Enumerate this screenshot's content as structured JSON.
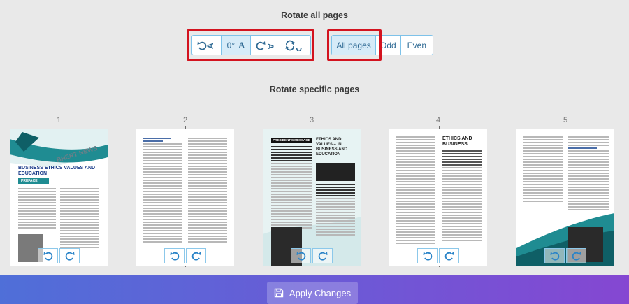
{
  "rotate_all": {
    "title": "Rotate all pages",
    "buttons": [
      {
        "icon": "rotate-left-icon",
        "glyph": "A"
      },
      {
        "label": "0°",
        "glyph": "A"
      },
      {
        "icon": "rotate-right-icon",
        "glyph": "A"
      },
      {
        "icon": "flip-icon",
        "glyph": "A"
      }
    ],
    "selection": [
      "All pages",
      "Odd",
      "Even"
    ],
    "selected": "All pages"
  },
  "rotate_specific": {
    "title": "Rotate specific pages",
    "pages": [
      {
        "num": "1"
      },
      {
        "num": "2"
      },
      {
        "num": "3"
      },
      {
        "num": "4"
      },
      {
        "num": "5"
      }
    ]
  },
  "thumb_text": {
    "p1_masthead": "BHERT NEWS",
    "p1_heading": "BUSINESS ETHICS VALUES AND EDUCATION",
    "p1_band": "PREFACE",
    "p3_banner": "PRESIDENT'S MESSAGE",
    "p3_heading": "ETHICS AND VALUES – IN BUSINESS AND EDUCATION",
    "p4_heading": "ETHICS AND BUSINESS"
  },
  "footer": {
    "apply_label": "Apply Changes"
  },
  "colors": {
    "accent": "#2f6a94",
    "highlight": "#d3131f",
    "teal": "#1f8c92"
  }
}
